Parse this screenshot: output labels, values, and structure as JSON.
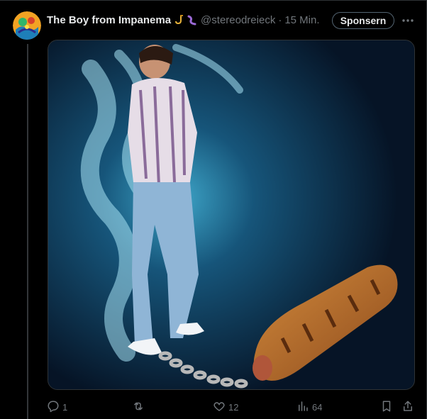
{
  "post": {
    "author_name": "The Boy from Impanema",
    "handle": "@stereodreieck",
    "separator": "·",
    "timestamp": "15 Min.",
    "emojis": [
      "saxophone-emoji",
      "worm-emoji"
    ],
    "sponsor_label": "Sponsern"
  },
  "media": {
    "description_icons": [
      "man-walking",
      "smoke-trail",
      "ball-and-chain-sausage-roll"
    ]
  },
  "actions": {
    "reply_count": "1",
    "repost_count": "",
    "like_count": "12",
    "view_count": "64"
  },
  "colors": {
    "background": "#000000",
    "text": "#e7e9ea",
    "muted": "#71767b",
    "border": "#2f3336"
  }
}
